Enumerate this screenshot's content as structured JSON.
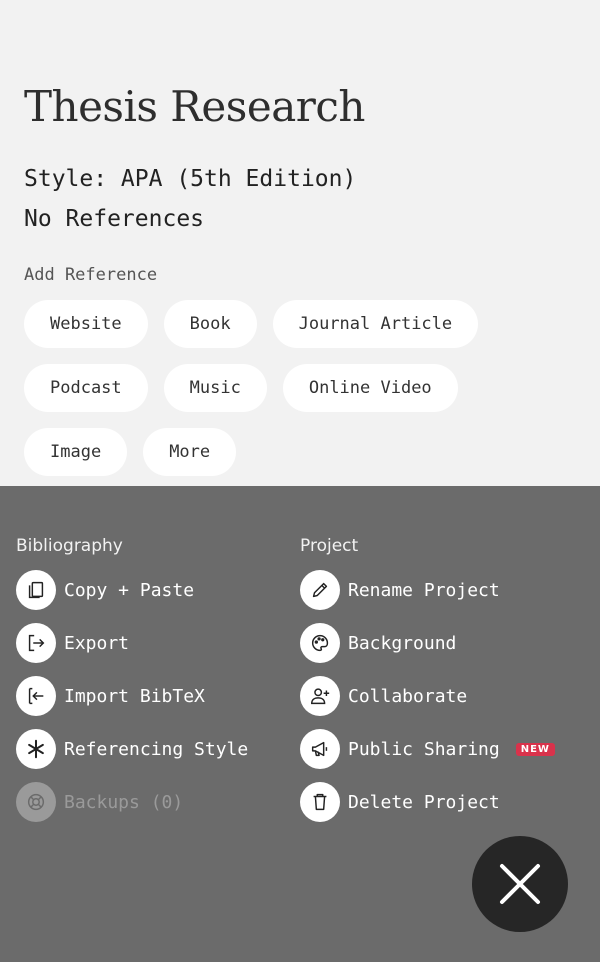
{
  "project": {
    "title": "Thesis Research",
    "style_line": "Style: APA (5th Edition)",
    "references_line": "No References"
  },
  "add_reference": {
    "heading": "Add Reference",
    "chips": [
      "Website",
      "Book",
      "Journal Article",
      "Podcast",
      "Music",
      "Online Video",
      "Image",
      "More"
    ]
  },
  "menu": {
    "bibliography": {
      "heading": "Bibliography",
      "items": [
        {
          "label": "Copy + Paste",
          "icon": "copy-icon"
        },
        {
          "label": "Export",
          "icon": "export-icon"
        },
        {
          "label": "Import BibTeX",
          "icon": "import-icon"
        },
        {
          "label": "Referencing Style",
          "icon": "asterisk-icon"
        },
        {
          "label": "Backups (0)",
          "icon": "lifebuoy-icon",
          "disabled": true
        }
      ]
    },
    "project": {
      "heading": "Project",
      "items": [
        {
          "label": "Rename Project",
          "icon": "pencil-icon"
        },
        {
          "label": "Background",
          "icon": "palette-icon"
        },
        {
          "label": "Collaborate",
          "icon": "add-user-icon"
        },
        {
          "label": "Public Sharing",
          "icon": "megaphone-icon",
          "badge": "NEW"
        },
        {
          "label": "Delete Project",
          "icon": "trash-icon"
        }
      ]
    }
  },
  "colors": {
    "background": "#f2f2f2",
    "sheet": "#6b6b6b",
    "close_button": "#262626",
    "badge": "#d9324b"
  }
}
